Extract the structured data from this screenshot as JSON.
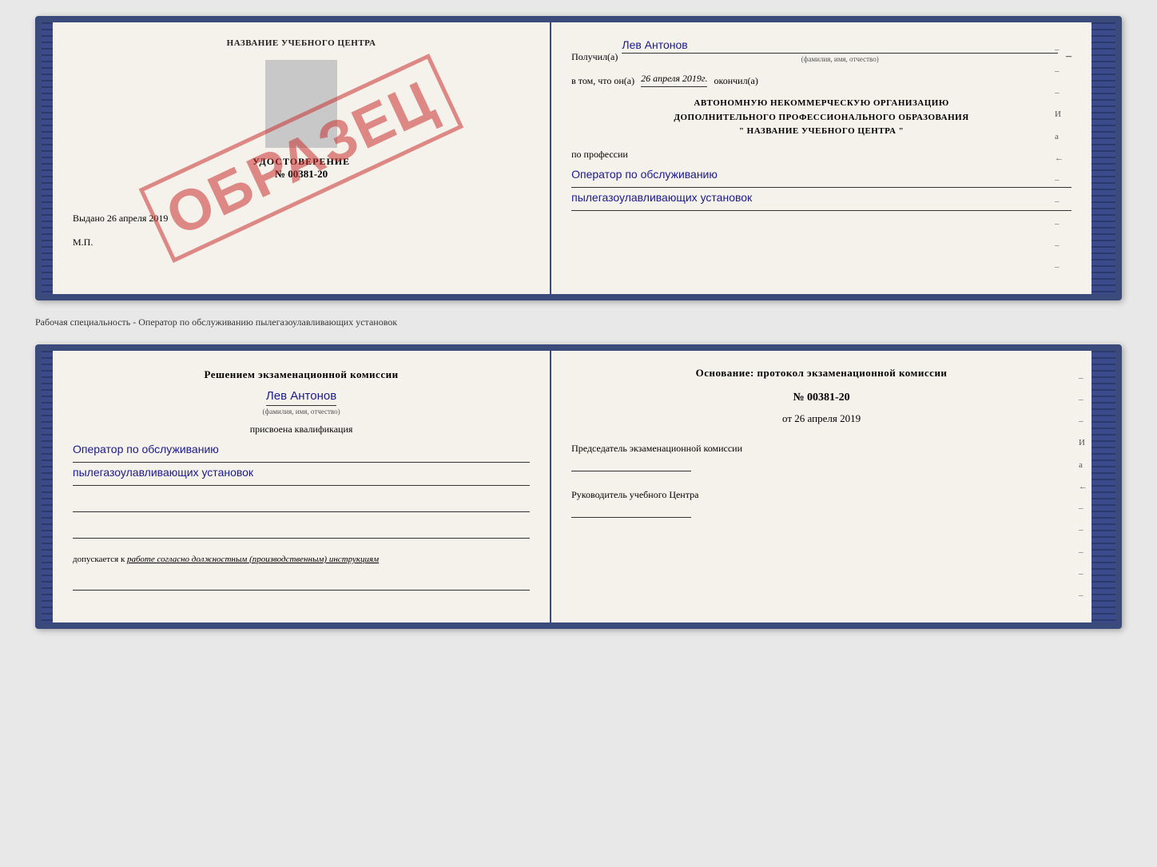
{
  "page": {
    "background": "#e8e8e8"
  },
  "top_book": {
    "left_page": {
      "header": "НАЗВАНИЕ УЧЕБНОГО ЦЕНТРА",
      "stamp_text": "ОБРАЗЕЦ",
      "udost_title": "УДОСТОВЕРЕНИЕ",
      "udost_number": "№ 00381-20",
      "vydano_label": "Выдано",
      "vydano_date": "26 апреля 2019",
      "mp_label": "М.П."
    },
    "right_page": {
      "received_label": "Получил(а)",
      "received_name": "Лев Антонов",
      "fio_label": "(фамилия, имя, отчество)",
      "dash": "–",
      "vtom_label": "в том, что он(а)",
      "date_value": "26 апреля 2019г.",
      "okonchil_label": "окончил(а)",
      "org_line1": "АВТОНОМНУЮ НЕКОММЕРЧЕСКУЮ ОРГАНИЗАЦИЮ",
      "org_line2": "ДОПОЛНИТЕЛЬНОГО ПРОФЕССИОНАЛЬНОГО ОБРАЗОВАНИЯ",
      "org_line3": "\"  НАЗВАНИЕ УЧЕБНОГО ЦЕНТРА  \"",
      "profession_label": "по профессии",
      "profession_line1": "Оператор по обслуживанию",
      "profession_line2": "пылегазоулавливающих установок",
      "margin_items": [
        "–",
        "–",
        "–",
        "И",
        "а",
        "←",
        "–",
        "–",
        "–",
        "–",
        "–"
      ]
    }
  },
  "middle_text": "Рабочая специальность - Оператор по обслуживанию пылегазоулавливающих установок",
  "bottom_book": {
    "left_page": {
      "reshen_label": "Решением экзаменационной комиссии",
      "person_name": "Лев Антонов",
      "fio_label": "(фамилия, имя, отчество)",
      "prisvoena_label": "присвоена квалификация",
      "qualification_line1": "Оператор по обслуживанию",
      "qualification_line2": "пылегазоулавливающих установок",
      "допускается_label": "допускается к",
      "допускается_text": "работе согласно должностным (производственным) инструкциям"
    },
    "right_page": {
      "osnov_label": "Основание: протокол экзаменационной комиссии",
      "protocol_number": "№  00381-20",
      "ot_label": "от",
      "ot_date": "26 апреля 2019",
      "predsedatel_label": "Председатель экзаменационной комиссии",
      "rukovoditel_label": "Руководитель учебного Центра",
      "margin_items": [
        "–",
        "–",
        "–",
        "И",
        "а",
        "←",
        "–",
        "–",
        "–",
        "–",
        "–"
      ]
    }
  }
}
